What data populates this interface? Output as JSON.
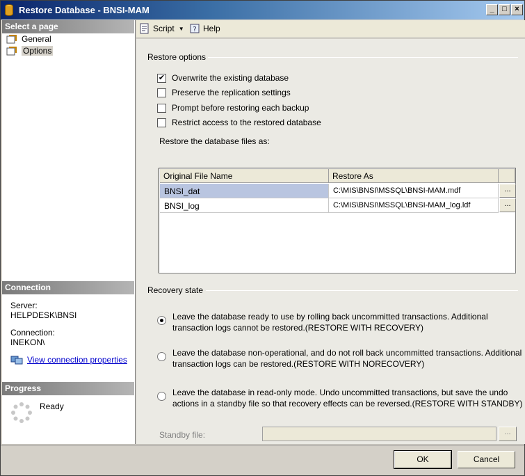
{
  "window": {
    "title": "Restore Database - BNSI-MAM"
  },
  "left_pane": {
    "select_header": "Select a page",
    "pages": [
      {
        "label": "General"
      },
      {
        "label": "Options"
      }
    ],
    "connection_header": "Connection",
    "server_label": "Server:",
    "server_value": "HELPDESK\\BNSI",
    "connection_label": "Connection:",
    "connection_value": "INEKON\\",
    "view_conn_link": "View connection properties",
    "progress_header": "Progress",
    "progress_status": "Ready"
  },
  "toolbar": {
    "script_label": "Script",
    "help_label": "Help"
  },
  "restore_options": {
    "group_label": "Restore options",
    "checkboxes": [
      {
        "label": "Overwrite the existing database",
        "checked": true
      },
      {
        "label": "Preserve the replication settings",
        "checked": false
      },
      {
        "label": "Prompt before restoring each backup",
        "checked": false
      },
      {
        "label": "Restrict access to the restored database",
        "checked": false
      }
    ],
    "files_label": "Restore the database files as:",
    "columns": [
      "Original File Name",
      "Restore As"
    ],
    "rows": [
      {
        "original": "BNSI_dat",
        "restore_as": "C:\\MIS\\BNSI\\MSSQL\\BNSI-MAM.mdf"
      },
      {
        "original": "BNSI_log",
        "restore_as": "C:\\MIS\\BNSI\\MSSQL\\BNSI-MAM_log.ldf"
      }
    ],
    "browse_label": "..."
  },
  "recovery_state": {
    "group_label": "Recovery state",
    "options": [
      {
        "line1": "Leave the database ready to use by rolling back uncommitted transactions. Additional",
        "line2": "transaction logs cannot be restored.(RESTORE WITH RECOVERY)",
        "selected": true
      },
      {
        "line1": "Leave the database non-operational, and do not roll back uncommitted transactions. Additional",
        "line2": "transaction logs can be restored.(RESTORE WITH NORECOVERY)",
        "selected": false
      },
      {
        "line1": "Leave the database in read-only mode. Undo uncommitted transactions, but save the undo",
        "line2": "actions in a standby file so that recovery effects can be reversed.(RESTORE WITH STANDBY)",
        "selected": false
      }
    ],
    "standby_label": "Standby file:",
    "standby_value": "",
    "standby_browse": "..."
  },
  "footer": {
    "ok_label": "OK",
    "cancel_label": "Cancel"
  }
}
